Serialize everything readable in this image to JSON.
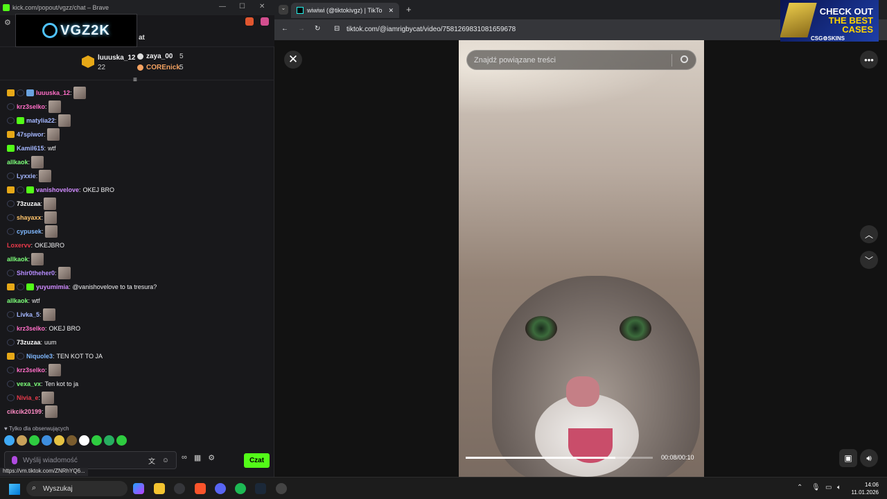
{
  "left_window": {
    "titlebar": {
      "title": "kick.com/popout/vgzz/chat – Brave"
    },
    "channel_logo_text": "VGZ2K",
    "header_fragment": "at",
    "top_gifters": [
      {
        "name": "luuuska_12",
        "count": "22",
        "color": "#ffd166"
      },
      {
        "name": "zaya_00",
        "count": "5",
        "color": "#ffffff"
      },
      {
        "name": "COREnick",
        "count": "5",
        "color": "#f4a261"
      }
    ],
    "messages": [
      {
        "badges": [
          "crown",
          "sub",
          "blue"
        ],
        "user": "luuuska_12",
        "color": "#ff6ec7",
        "text": "",
        "emote": true
      },
      {
        "badges": [
          "sub"
        ],
        "user": "krz3selko",
        "color": "#ff6ec7",
        "text": "",
        "emote": true
      },
      {
        "badges": [
          "sub",
          "gift"
        ],
        "user": "matylia22",
        "color": "#a4b7ff",
        "text": "",
        "emote": true
      },
      {
        "badges": [
          "crown"
        ],
        "user": "47spiwor",
        "color": "#a4b7ff",
        "text": "",
        "emote": true
      },
      {
        "badges": [
          "gift"
        ],
        "user": "Kamil615",
        "color": "#a4b7ff",
        "text": "wtf",
        "emote": false
      },
      {
        "badges": [],
        "user": "allkaok",
        "color": "#7dff7a",
        "text": "",
        "emote": true
      },
      {
        "badges": [
          "sub"
        ],
        "user": "Lyxxie",
        "color": "#a4b7ff",
        "text": "",
        "emote": true
      },
      {
        "badges": [
          "crown",
          "sub",
          "gift"
        ],
        "user": "vanishovelove",
        "color": "#d08cff",
        "text": "OKEJ BRO",
        "emote": false
      },
      {
        "badges": [
          "sub"
        ],
        "user": "73zuzaa",
        "color": "#ffffff",
        "text": "",
        "emote": true
      },
      {
        "badges": [
          "sub"
        ],
        "user": "shayaxx",
        "color": "#ffc46b",
        "text": "",
        "emote": true
      },
      {
        "badges": [
          "sub"
        ],
        "user": "cypusek",
        "color": "#7fb8ff",
        "text": "",
        "emote": true
      },
      {
        "badges": [],
        "user": "Loxervv",
        "color": "#e8394a",
        "text": "OKEJBRO",
        "emote": false
      },
      {
        "badges": [],
        "user": "allkaok",
        "color": "#7dff7a",
        "text": "",
        "emote": true
      },
      {
        "badges": [
          "sub"
        ],
        "user": "Shir0theher0",
        "color": "#b68cff",
        "text": "",
        "emote": true
      },
      {
        "badges": [
          "crown",
          "sub",
          "gift"
        ],
        "user": "yuyumimia",
        "color": "#d08cff",
        "text": "@vanishovelove to ta tresura?",
        "emote": false
      },
      {
        "badges": [],
        "user": "allkaok",
        "color": "#7dff7a",
        "text": "wtf",
        "emote": false
      },
      {
        "badges": [
          "sub"
        ],
        "user": "Livka_5",
        "color": "#a4b7ff",
        "text": "",
        "emote": true
      },
      {
        "badges": [
          "sub"
        ],
        "user": "krz3selko",
        "color": "#ff6ec7",
        "text": "OKEJ BRO",
        "emote": false
      },
      {
        "badges": [
          "sub"
        ],
        "user": "73zuzaa",
        "color": "#ffffff",
        "text": "uum",
        "emote": false
      },
      {
        "badges": [
          "crown",
          "sub"
        ],
        "user": "Niquole3",
        "color": "#7fb8ff",
        "text": "TEN KOT TO JA",
        "emote": false
      },
      {
        "badges": [
          "sub"
        ],
        "user": "krz3selko",
        "color": "#ff6ec7",
        "text": "",
        "emote": true
      },
      {
        "badges": [
          "sub"
        ],
        "user": "vexa_vx",
        "color": "#7dff7a",
        "text": "Ten kot to ja",
        "emote": false
      },
      {
        "badges": [
          "sub"
        ],
        "user": "Nivia_e",
        "color": "#e8394a",
        "text": "",
        "emote": true
      },
      {
        "badges": [],
        "user": "cikcik20199",
        "color": "#ff8cc6",
        "text": "",
        "emote": true
      }
    ],
    "follow_note": "Tylko dla obserwujących",
    "input_placeholder": "Wyślij wiadomość",
    "send_label": "Czat",
    "status_url": "https://vm.tiktok.com/ZNRhYQ6..."
  },
  "right_window": {
    "tab_title": "wiwiwi (@tiktokivgz) | TikTo",
    "url": "tiktok.com/@iamrigbycat/video/7581269831081659678",
    "ad": {
      "line1": "CHECK OUT",
      "line2": "THE BEST",
      "line3": "CASES",
      "brand": "CSG⚙SKINS"
    },
    "search_placeholder": "Znajdź powiązane treści",
    "timecode": "00:08/00:10",
    "progress": 0.8
  },
  "taskbar": {
    "search_label": "Wyszukaj",
    "time": "14:06",
    "date": "11.01.2026"
  }
}
